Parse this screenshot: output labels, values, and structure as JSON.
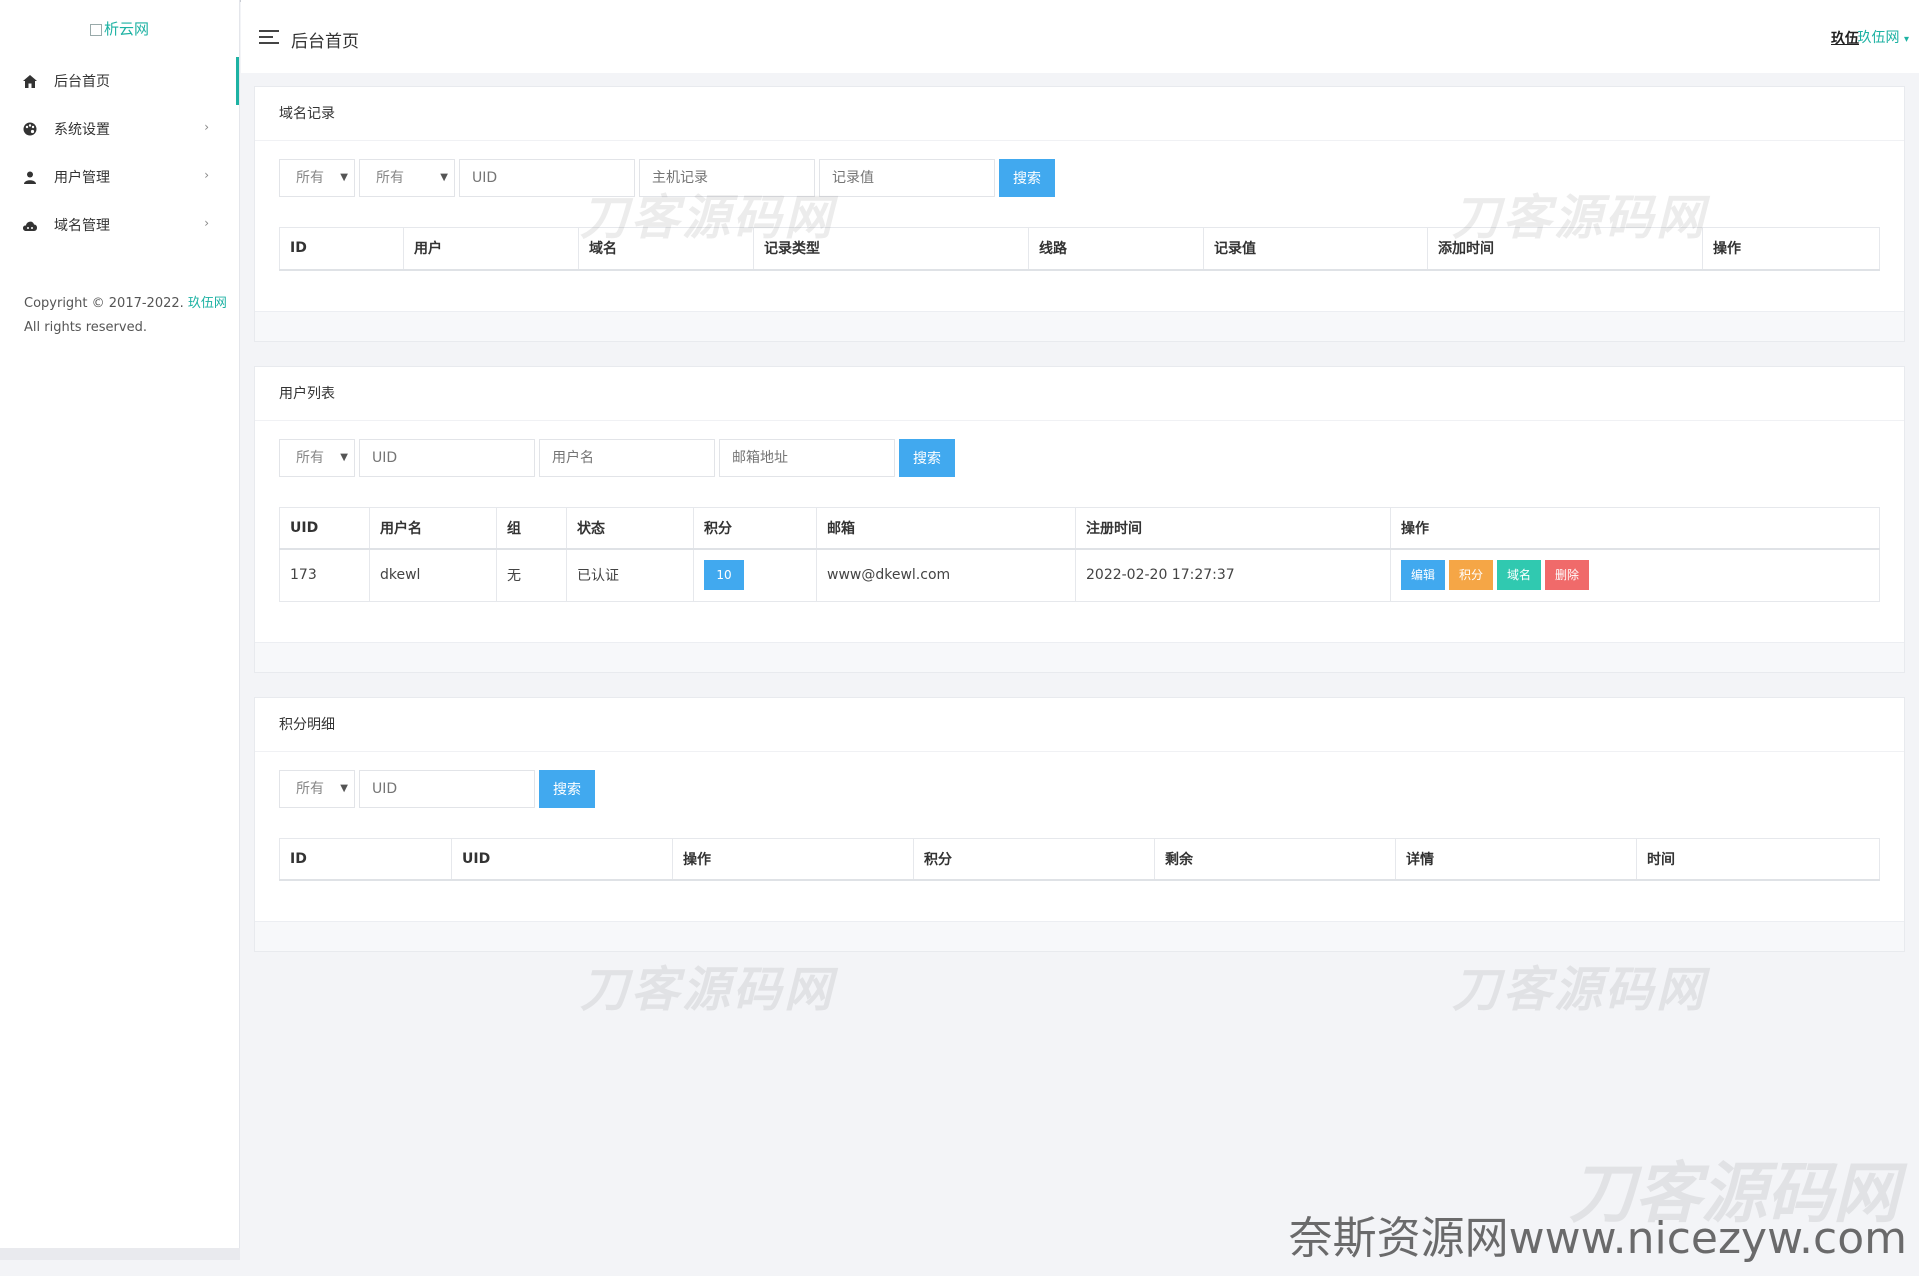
{
  "sidebar": {
    "logo_alt": "析云网",
    "items": [
      {
        "label": "后台首页",
        "icon": "home-icon"
      },
      {
        "label": "系统设置",
        "icon": "palette-icon"
      },
      {
        "label": "用户管理",
        "icon": "user-icon"
      },
      {
        "label": "域名管理",
        "icon": "cloud-icon"
      }
    ],
    "copyright_text": "Copyright © 2017-2022.",
    "copyright_brand": "玖伍网",
    "rights": "All rights reserved."
  },
  "header": {
    "title": "后台首页",
    "user": "玖伍",
    "site": "玖伍网"
  },
  "domain_records": {
    "title": "域名记录",
    "filter1": "所有",
    "filter2": "所有",
    "uid_placeholder": "UID",
    "host_placeholder": "主机记录",
    "value_placeholder": "记录值",
    "search_label": "搜索",
    "columns": [
      "ID",
      "用户",
      "域名",
      "记录类型",
      "线路",
      "记录值",
      "添加时间",
      "操作"
    ]
  },
  "user_list": {
    "title": "用户列表",
    "filter": "所有",
    "uid_placeholder": "UID",
    "username_placeholder": "用户名",
    "email_placeholder": "邮箱地址",
    "search_label": "搜索",
    "columns": [
      "UID",
      "用户名",
      "组",
      "状态",
      "积分",
      "邮箱",
      "注册时间",
      "操作"
    ],
    "rows": [
      {
        "uid": "173",
        "username": "dkewl",
        "group": "无",
        "status": "已认证",
        "points": "10",
        "email": "www@dkewl.com",
        "registered": "2022-02-20 17:27:37",
        "actions": [
          "编辑",
          "积分",
          "域名",
          "删除"
        ]
      }
    ]
  },
  "points_detail": {
    "title": "积分明细",
    "filter": "所有",
    "uid_placeholder": "UID",
    "search_label": "搜索",
    "columns": [
      "ID",
      "UID",
      "操作",
      "积分",
      "剩余",
      "详情",
      "时间"
    ]
  },
  "watermarks": {
    "repeat": "刀客源码网",
    "footer": "奈斯资源网www.nicezyw.com"
  }
}
